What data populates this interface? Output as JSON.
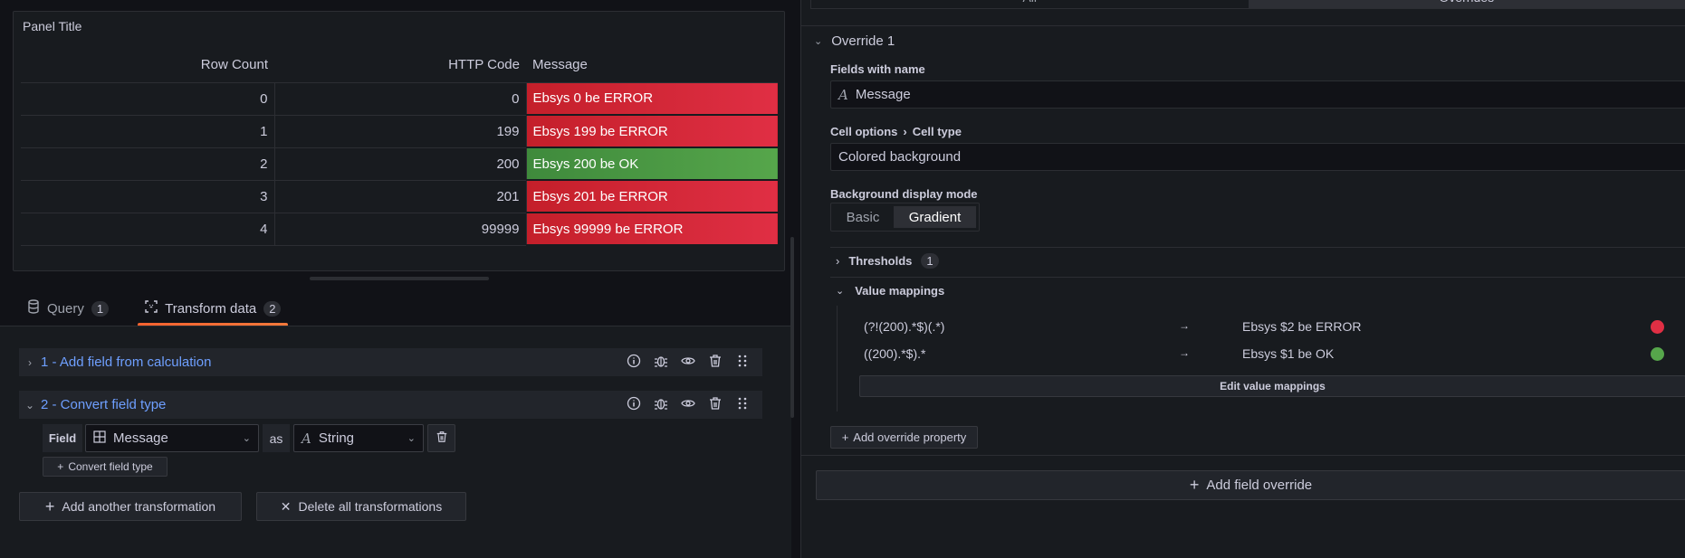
{
  "panel": {
    "title": "Panel Title",
    "columns": [
      "Row Count",
      "HTTP Code",
      "Message"
    ],
    "rows": [
      {
        "row_count": "0",
        "http_code": "0",
        "message": "Ebsys 0 be ERROR",
        "status": "error"
      },
      {
        "row_count": "1",
        "http_code": "199",
        "message": "Ebsys 199 be ERROR",
        "status": "error"
      },
      {
        "row_count": "2",
        "http_code": "200",
        "message": "Ebsys 200 be OK",
        "status": "ok"
      },
      {
        "row_count": "3",
        "http_code": "201",
        "message": "Ebsys 201 be ERROR",
        "status": "error"
      },
      {
        "row_count": "4",
        "http_code": "99999",
        "message": "Ebsys 99999 be ERROR",
        "status": "error"
      }
    ]
  },
  "colors": {
    "error": "#e02f44",
    "ok": "#56a64b",
    "accent": "#f5622f",
    "link": "#6e9fff"
  },
  "tabs": [
    {
      "label": "Query",
      "count": "1"
    },
    {
      "label": "Transform data",
      "count": "2"
    }
  ],
  "transformations": [
    {
      "title": "1 - Add field from calculation",
      "expanded": false
    },
    {
      "title": "2 - Convert field type",
      "expanded": true
    }
  ],
  "convert": {
    "field_label": "Field",
    "field_value": "Message",
    "as_label": "as",
    "type_value": "String",
    "add_button": "Convert field type"
  },
  "actions": {
    "add_transformation": "Add another transformation",
    "delete_all": "Delete all transformations"
  },
  "right": {
    "top_tabs": [
      "All",
      "Overrides"
    ],
    "override_title": "Override 1",
    "fields_with_name_label": "Fields with name",
    "fields_with_name_value": "Message",
    "cell_options_label": "Cell options",
    "cell_type_label": "Cell type",
    "cell_type_value": "Colored background",
    "bg_mode_label": "Background display mode",
    "bg_mode_options": [
      "Basic",
      "Gradient"
    ],
    "bg_mode_selected": "Gradient",
    "thresholds_label": "Thresholds",
    "thresholds_count": "1",
    "value_mappings_label": "Value mappings",
    "mappings": [
      {
        "pattern": "(?!(200).*$)(.*)",
        "result": "Ebsys $2 be ERROR",
        "color": "#e02f44"
      },
      {
        "pattern": "((200).*$).*",
        "result": "Ebsys $1 be OK",
        "color": "#56a64b"
      }
    ],
    "edit_mappings": "Edit value mappings",
    "add_override_property": "Add override property",
    "add_field_override": "Add field override"
  }
}
